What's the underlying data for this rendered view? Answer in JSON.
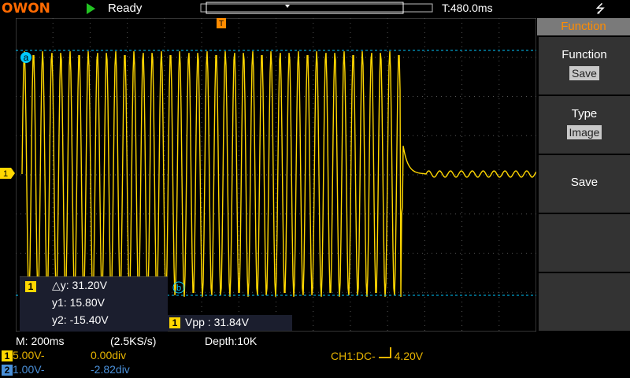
{
  "topbar": {
    "brand": "OWON",
    "run_status": "Ready",
    "trigger_time": "T:480.0ms",
    "usb_icon": "usb-icon"
  },
  "menu": {
    "header": "Function",
    "items": [
      {
        "label": "Function",
        "value": "Save"
      },
      {
        "label": "Type",
        "value": "Image"
      },
      {
        "label": "Save",
        "value": ""
      }
    ]
  },
  "markers": {
    "cursor_a": "a",
    "cursor_b": "b",
    "ch1_marker": "1",
    "trigger_marker": "T"
  },
  "cursor_measure": {
    "channel": "1",
    "delta_y": "△y: 31.20V",
    "y1": "y1: 15.80V",
    "y2": "y2: -15.40V"
  },
  "measurement": {
    "channel": "1",
    "vpp": "Vpp : 31.84V"
  },
  "status": {
    "timebase": "M: 200ms",
    "sample_rate": "(2.5KS/s)",
    "depth": "Depth:10K"
  },
  "channels": [
    {
      "num": "1",
      "scale": "5.00V-",
      "offset": "0.00div",
      "color": "#e8b400"
    },
    {
      "num": "2",
      "scale": "1.00V-",
      "offset": "-2.82div",
      "color": "#4a90d9"
    }
  ],
  "trigger": {
    "text": "CH1:DC-",
    "level": "4.20V"
  },
  "colors": {
    "trace": "#ffd700",
    "grid": "#555555",
    "cursor": "#00c8ff",
    "accent": "#ff8c00"
  }
}
